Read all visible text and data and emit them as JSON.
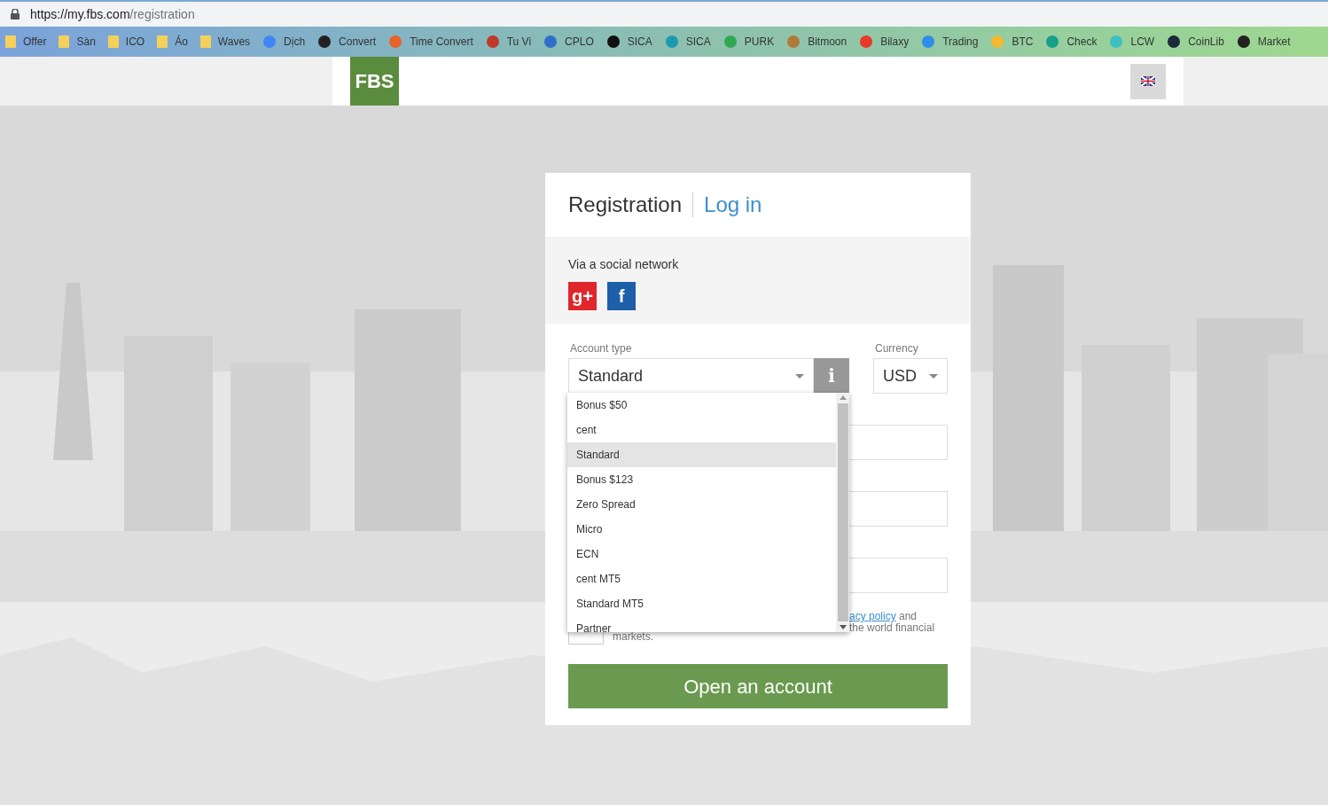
{
  "address_bar": {
    "url_host": "https://my.fbs.com",
    "url_path": "/registration"
  },
  "bookmarks": [
    {
      "label": "Offer",
      "kind": "folder"
    },
    {
      "label": "Sàn",
      "kind": "folder"
    },
    {
      "label": "ICO",
      "kind": "folder"
    },
    {
      "label": "Áo",
      "kind": "folder"
    },
    {
      "label": "Waves",
      "kind": "folder"
    },
    {
      "label": "Dịch",
      "kind": "site",
      "color": "#4285f4"
    },
    {
      "label": "Convert",
      "kind": "site",
      "color": "#222222"
    },
    {
      "label": "Time Convert",
      "kind": "site",
      "color": "#e8622c"
    },
    {
      "label": "Tu Vi",
      "kind": "site",
      "color": "#c0392b"
    },
    {
      "label": "CPLO",
      "kind": "site",
      "color": "#2f6fc9"
    },
    {
      "label": "SICA",
      "kind": "site",
      "color": "#111111"
    },
    {
      "label": "SICA",
      "kind": "site",
      "color": "#1c9bb0"
    },
    {
      "label": "PURK",
      "kind": "site",
      "color": "#2fa84f"
    },
    {
      "label": "Bitmoon",
      "kind": "site",
      "color": "#b07a3a"
    },
    {
      "label": "Bilaxy",
      "kind": "site",
      "color": "#e8392b"
    },
    {
      "label": "Trading",
      "kind": "site",
      "color": "#2d8ee8"
    },
    {
      "label": "BTC",
      "kind": "site",
      "color": "#f3ba2f"
    },
    {
      "label": "Check",
      "kind": "site",
      "color": "#17a08a"
    },
    {
      "label": "LCW",
      "kind": "site",
      "color": "#3cc0c0"
    },
    {
      "label": "CoinLib",
      "kind": "site",
      "color": "#1b2a3a"
    },
    {
      "label": "Market",
      "kind": "site",
      "color": "#222222"
    }
  ],
  "header": {
    "logo": "FBS"
  },
  "card": {
    "tabs": [
      {
        "label": "Registration",
        "selected": true
      },
      {
        "label": "Log in",
        "selected": false
      }
    ],
    "social_label": "Via a social network",
    "social_buttons": [
      {
        "label": "g+",
        "color": "#e0262b"
      },
      {
        "label": "f",
        "color": "#1d5fa8"
      }
    ],
    "account_type": {
      "label": "Account type",
      "value": "Standard",
      "info": "i"
    },
    "currency": {
      "label": "Currency",
      "value": "USD"
    },
    "consent_checkbox": {
      "checked": false
    },
    "consent_fragments": {
      "link": "acy policy",
      "line1_rest": " and",
      "line2": "the world financial",
      "line3": "markets."
    },
    "submit": "Open an account",
    "dropdown": [
      {
        "label": "Bonus $50",
        "selected": false
      },
      {
        "label": "cent",
        "selected": false
      },
      {
        "label": "Standard",
        "selected": true
      },
      {
        "label": "Bonus $123",
        "selected": false
      },
      {
        "label": "Zero Spread",
        "selected": false
      },
      {
        "label": "Micro",
        "selected": false
      },
      {
        "label": "ECN",
        "selected": false
      },
      {
        "label": "cent MT5",
        "selected": false
      },
      {
        "label": "Standard MT5",
        "selected": false
      },
      {
        "label": "Partner",
        "selected": false
      }
    ]
  }
}
